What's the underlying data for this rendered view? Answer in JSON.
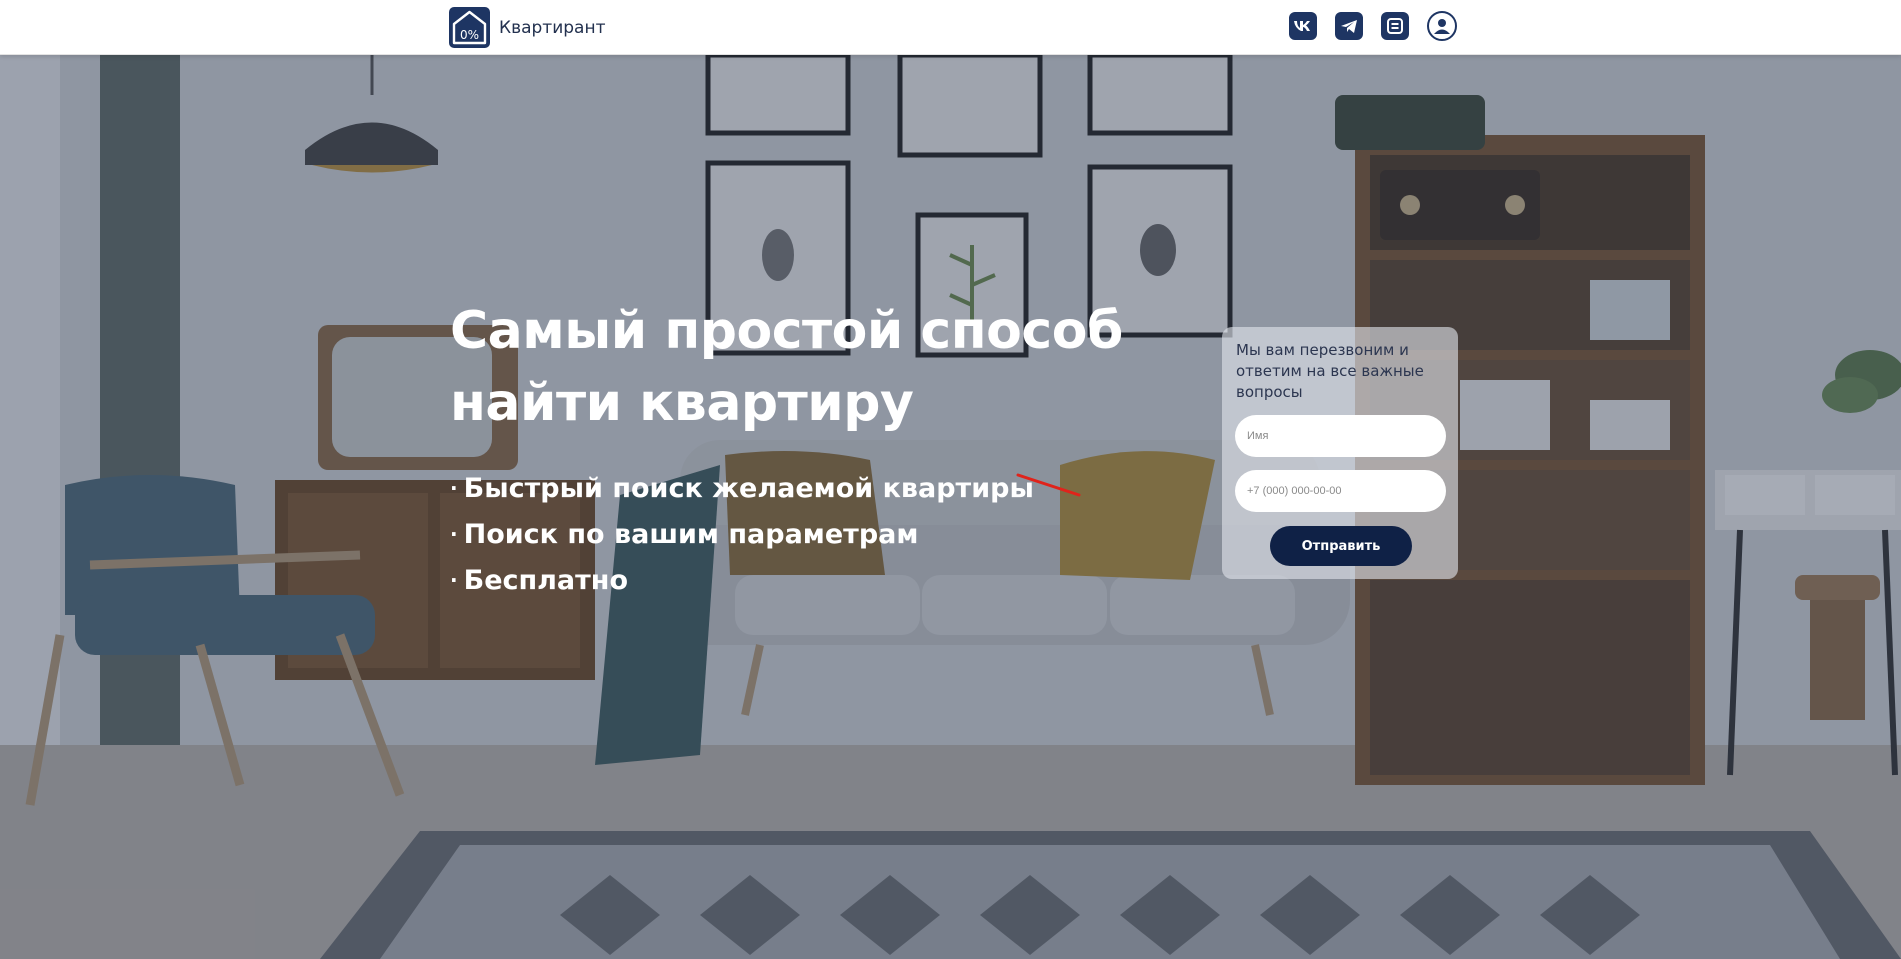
{
  "header": {
    "brand_name": "Квартирант",
    "logo_badge": "0%",
    "icons": [
      "vk-icon",
      "telegram-icon",
      "menu-list-icon",
      "profile-icon"
    ]
  },
  "hero": {
    "title": "Самый простой способ найти квартиру",
    "bullet": "·",
    "features": [
      "Быстрый поиск желаемой квартиры",
      "Поиск по вашим параметрам",
      "Бесплатно"
    ]
  },
  "form": {
    "caption": "Мы вам перезвоним и ответим на все важные вопросы",
    "name_placeholder": "Имя",
    "phone_placeholder": "+7 (000) 000-00-00",
    "submit_label": "Отправить"
  },
  "colors": {
    "brand": "#1e3563",
    "button": "#0f2146",
    "overlay": "rgba(40,52,78,0.38)"
  }
}
